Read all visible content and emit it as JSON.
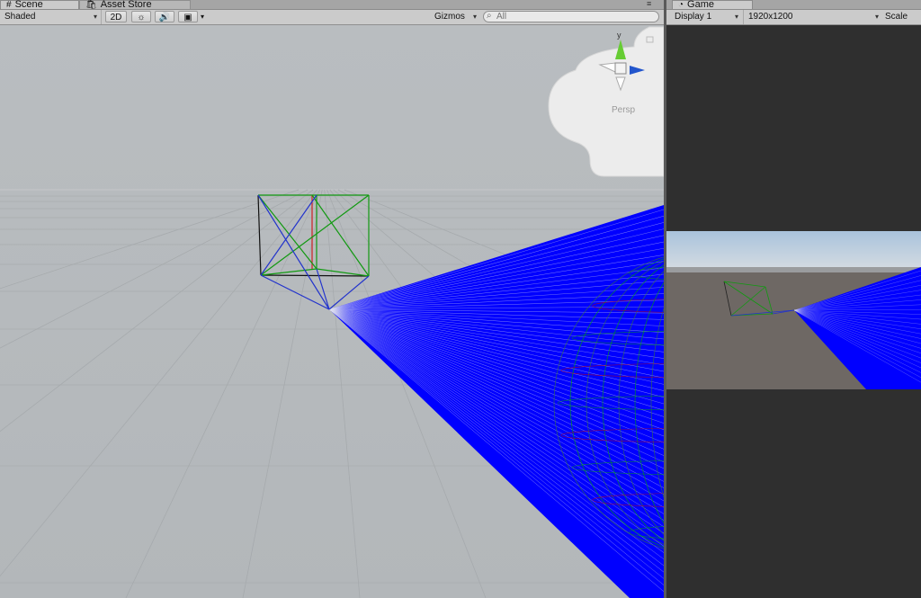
{
  "scene_tab": {
    "icon": "#",
    "label": "Scene"
  },
  "asset_store_tab": {
    "label": "Asset Store"
  },
  "game_tab": {
    "label": "Game"
  },
  "scene_toolbar": {
    "shading_mode": "Shaded",
    "mode_2d": "2D",
    "gizmos_label": "Gizmos",
    "search_placeholder": "All"
  },
  "gizmo": {
    "axis_y": "y",
    "projection": "Persp"
  },
  "game_toolbar": {
    "display": "Display 1",
    "resolution": "1920x1200",
    "scale_label": "Scale"
  },
  "colors": {
    "ray": "#0000ff",
    "wire_green": "#00aa00",
    "wire_red": "#cc0000",
    "scene_bg": "#b4b8bb",
    "game_sky": "#b8cde0",
    "game_ground": "#6e6864",
    "game_bg": "#2f2f2f"
  }
}
